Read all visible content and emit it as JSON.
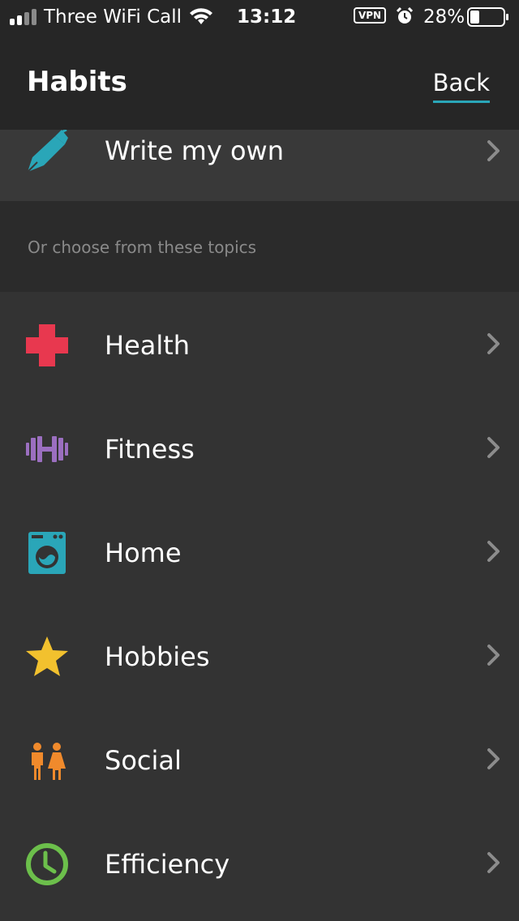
{
  "status_bar": {
    "carrier": "Three WiFi Call",
    "time": "13:12",
    "vpn": "VPN",
    "battery": "28%",
    "battery_level": 0.28
  },
  "header": {
    "title": "Habits",
    "back_label": "Back"
  },
  "write_own": {
    "label": "Write my own",
    "icon": "pen-icon"
  },
  "section_caption": "Or choose from these topics",
  "topics": [
    {
      "label": "Health",
      "icon": "health-cross-icon",
      "color": "#e8384f"
    },
    {
      "label": "Fitness",
      "icon": "dumbbell-icon",
      "color": "#9b6fc0"
    },
    {
      "label": "Home",
      "icon": "washing-machine-icon",
      "color": "#2aa6b8"
    },
    {
      "label": "Hobbies",
      "icon": "star-icon",
      "color": "#f2c12e"
    },
    {
      "label": "Social",
      "icon": "people-icon",
      "color": "#f08a2c"
    },
    {
      "label": "Efficiency",
      "icon": "clock-icon",
      "color": "#6cbf4b"
    }
  ],
  "colors": {
    "background": "#333333",
    "header": "#262626",
    "accent": "#2aa6b8"
  }
}
